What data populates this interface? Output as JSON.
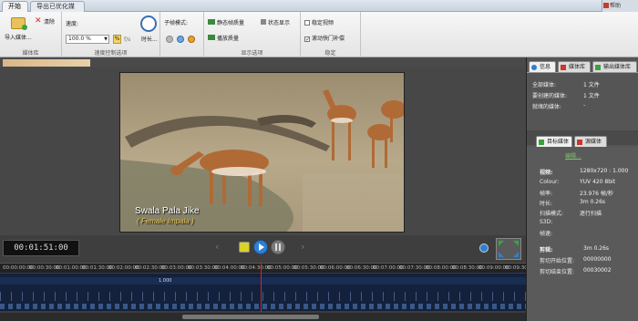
{
  "tabs": [
    "开始",
    "导出已优化媒体"
  ],
  "brand": "帮助",
  "ribbon": {
    "import_label": "导入媒体...",
    "clear_label": "清除",
    "media_group": "媒体库",
    "speed_label": "速度:",
    "speed_value": "100.0 %",
    "percent_btn": "%",
    "fps_btn": "f/s",
    "speed_group": "速度控制选项",
    "clock_label": "时长...",
    "frame_mode_label": "子帧模式:",
    "static_quality": "静态帧质量",
    "playback_quality": "播放质量",
    "status_display": "状态显示",
    "display_group": "显示选项",
    "stabilize_video": "稳定视频",
    "rolling_shutter": "滚动快门补偿",
    "stabilize_group": "稳定"
  },
  "file_name": "",
  "video": {
    "subtitle_main": "Swala Pala Jike",
    "subtitle_sub": "( Female Impala )"
  },
  "controls": {
    "timecode": "00:01:51:00"
  },
  "timeline": {
    "ticks": [
      "00:00:00:00",
      "00:00:30:00",
      "00:01:00:00",
      "00:01:30:00",
      "00:02:00:00",
      "00:02:30:00",
      "00:03:00:00",
      "00:03:30:00",
      "00:04:00:00",
      "00:04:30:00",
      "00:05:00:00",
      "00:05:30:00",
      "00:06:00:00",
      "00:06:30:00",
      "00:07:00:00",
      "00:07:30:00",
      "00:08:00:00",
      "00:08:30:00",
      "00:09:00:00",
      "00:09:30:00"
    ],
    "clip_label": "1.000"
  },
  "panel": {
    "tabs": [
      "信息",
      "媒体库",
      "输出媒体库"
    ],
    "info_rows": [
      {
        "k": "全部媒体:",
        "v": "1 文件"
      },
      {
        "k": "要创建的媒体:",
        "v": "1 文件"
      },
      {
        "k": "就绪的媒体:",
        "v": "-"
      }
    ],
    "media_tabs": [
      "目标媒体",
      "源媒体"
    ],
    "edit_link": "编辑...",
    "video_header": "视频:",
    "video_rows": [
      {
        "k": "分辨率:",
        "v": "1280x720 : 1.000"
      },
      {
        "k": "Colour:",
        "v": "YUV 420 8bit"
      },
      {
        "k": "帧率:",
        "v": "23.976 帧/秒"
      },
      {
        "k": "时长:",
        "v": "3m 0.26s"
      },
      {
        "k": "扫描模式:",
        "v": "逐行扫描"
      },
      {
        "k": "S3D:",
        "v": "-"
      },
      {
        "k": "帧速:",
        "v": ""
      }
    ],
    "audio_header": "剪辑:",
    "audio_rows": [
      {
        "k": "时长:",
        "v": "3m 0.26s"
      },
      {
        "k": "剪切开始位置:",
        "v": "00000000"
      },
      {
        "k": "剪切结束位置:",
        "v": "00030002"
      }
    ]
  }
}
